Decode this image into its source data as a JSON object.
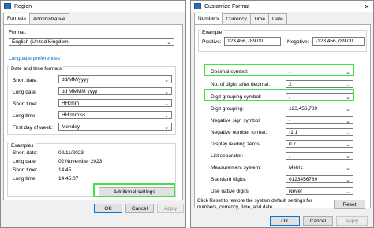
{
  "region": {
    "title": "Region",
    "tabs": [
      "Formats",
      "Administrative"
    ],
    "format_label": "Format:",
    "format_value": "English (United Kingdom)",
    "language_link": "Language preferences",
    "datetime_group": "Date and time formats",
    "rows": [
      {
        "label": "Short date:",
        "value": "dd/MM/yyyy"
      },
      {
        "label": "Long date:",
        "value": "dd MMMM yyyy"
      },
      {
        "label": "Short time:",
        "value": "HH:mm"
      },
      {
        "label": "Long time:",
        "value": "HH:mm:ss"
      },
      {
        "label": "First day of week:",
        "value": "Monday"
      }
    ],
    "examples_group": "Examples",
    "examples": [
      {
        "label": "Short date:",
        "value": "02/11/2023"
      },
      {
        "label": "Long date:",
        "value": "02 November 2023"
      },
      {
        "label": "Short time:",
        "value": "14:45"
      },
      {
        "label": "Long time:",
        "value": "14:45:07"
      }
    ],
    "additional_settings": "Additional settings...",
    "ok": "OK",
    "cancel": "Cancel",
    "apply": "Apply"
  },
  "customize": {
    "title": "Customize Format",
    "tabs": [
      "Numbers",
      "Currency",
      "Time",
      "Date"
    ],
    "example_label": "Example",
    "positive_label": "Positive:",
    "positive_value": "123,456,789.00",
    "negative_label": "Negative:",
    "negative_value": "-123,456,789.00",
    "rows": [
      {
        "label": "Decimal symbol:",
        "value": "."
      },
      {
        "label": "No. of digits after decimal:",
        "value": "2"
      },
      {
        "label": "Digit grouping symbol:",
        "value": ","
      },
      {
        "label": "Digit grouping:",
        "value": "123,456,789"
      },
      {
        "label": "Negative sign symbol:",
        "value": "-"
      },
      {
        "label": "Negative number format:",
        "value": "-1.1"
      },
      {
        "label": "Display leading zeros:",
        "value": "0.7"
      },
      {
        "label": "List separator:",
        "value": ","
      },
      {
        "label": "Measurement system:",
        "value": "Metric"
      },
      {
        "label": "Standard digits:",
        "value": "0123456789"
      },
      {
        "label": "Use native digits:",
        "value": "Never"
      }
    ],
    "reset_text": "Click Reset to restore the system default settings for numbers, currency, time, and date.",
    "reset": "Reset",
    "ok": "OK",
    "cancel": "Cancel",
    "apply": "Apply"
  },
  "colors": {
    "highlight": "#43e048",
    "link": "#0066cc",
    "focus": "#0078d7"
  },
  "icons": [
    "region-icon",
    "customize-icon",
    "close-icon",
    "chevron-down-icon"
  ]
}
